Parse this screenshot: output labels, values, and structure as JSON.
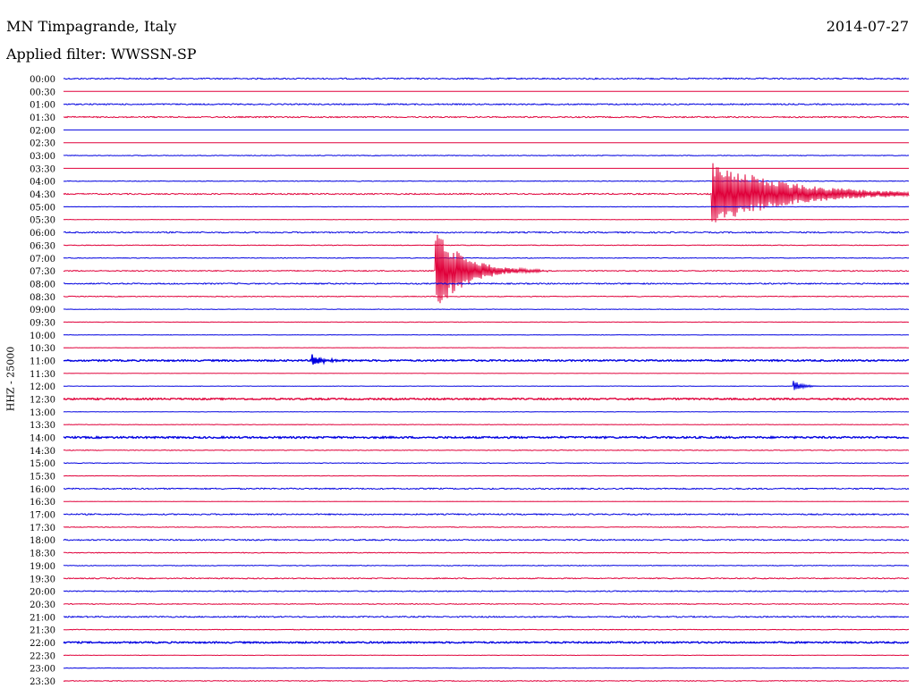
{
  "header": {
    "station": "MN Timpagrande, Italy",
    "date": "2014-07-27",
    "filter": "Applied filter: WWSSN-SP"
  },
  "chart_data": {
    "type": "line",
    "description_units": "time of day (UTC) vs trace amplitude",
    "channel_label": "HHZ - 25000",
    "colors": {
      "even_hour": "#0000e0",
      "half_hour": "#e0003a"
    },
    "rows": [
      "00:00",
      "00:30",
      "01:00",
      "01:30",
      "02:00",
      "02:30",
      "03:00",
      "03:30",
      "04:00",
      "04:30",
      "05:00",
      "05:30",
      "06:00",
      "06:30",
      "07:00",
      "07:30",
      "08:00",
      "08:30",
      "09:00",
      "09:30",
      "10:00",
      "10:30",
      "11:00",
      "11:30",
      "12:00",
      "12:30",
      "13:00",
      "13:30",
      "14:00",
      "14:30",
      "15:00",
      "15:30",
      "16:00",
      "16:30",
      "17:00",
      "17:30",
      "18:00",
      "18:30",
      "19:00",
      "19:30",
      "20:00",
      "20:30",
      "21:00",
      "21:30",
      "22:00",
      "22:30",
      "23:00",
      "23:30"
    ],
    "noise_level": [
      1,
      0,
      1,
      1,
      0,
      0,
      0.5,
      0,
      0.5,
      1,
      0.3,
      0.3,
      1,
      0.5,
      0.5,
      0.8,
      1,
      0.6,
      0.4,
      0.3,
      0.3,
      0.2,
      1.2,
      0.2,
      0.3,
      1.2,
      0.3,
      0.4,
      1.4,
      0.5,
      0.5,
      0.3,
      1.0,
      0.2,
      1.0,
      0.5,
      1.0,
      0.6,
      0.5,
      0.8,
      0.8,
      0.6,
      1.0,
      0.5,
      1.2,
      0.3,
      0.4,
      0.6
    ],
    "events": [
      {
        "row": "04:30",
        "minute": 23.0,
        "amplitude": 1.0,
        "duration_min": 10
      },
      {
        "row": "07:30",
        "minute": 13.2,
        "amplitude": 1.25,
        "duration_min": 4
      },
      {
        "row": "11:00",
        "minute": 8.8,
        "amplitude": 0.18,
        "duration_min": 1.5
      },
      {
        "row": "12:00",
        "minute": 25.9,
        "amplitude": 0.18,
        "duration_min": 1.2
      }
    ]
  }
}
